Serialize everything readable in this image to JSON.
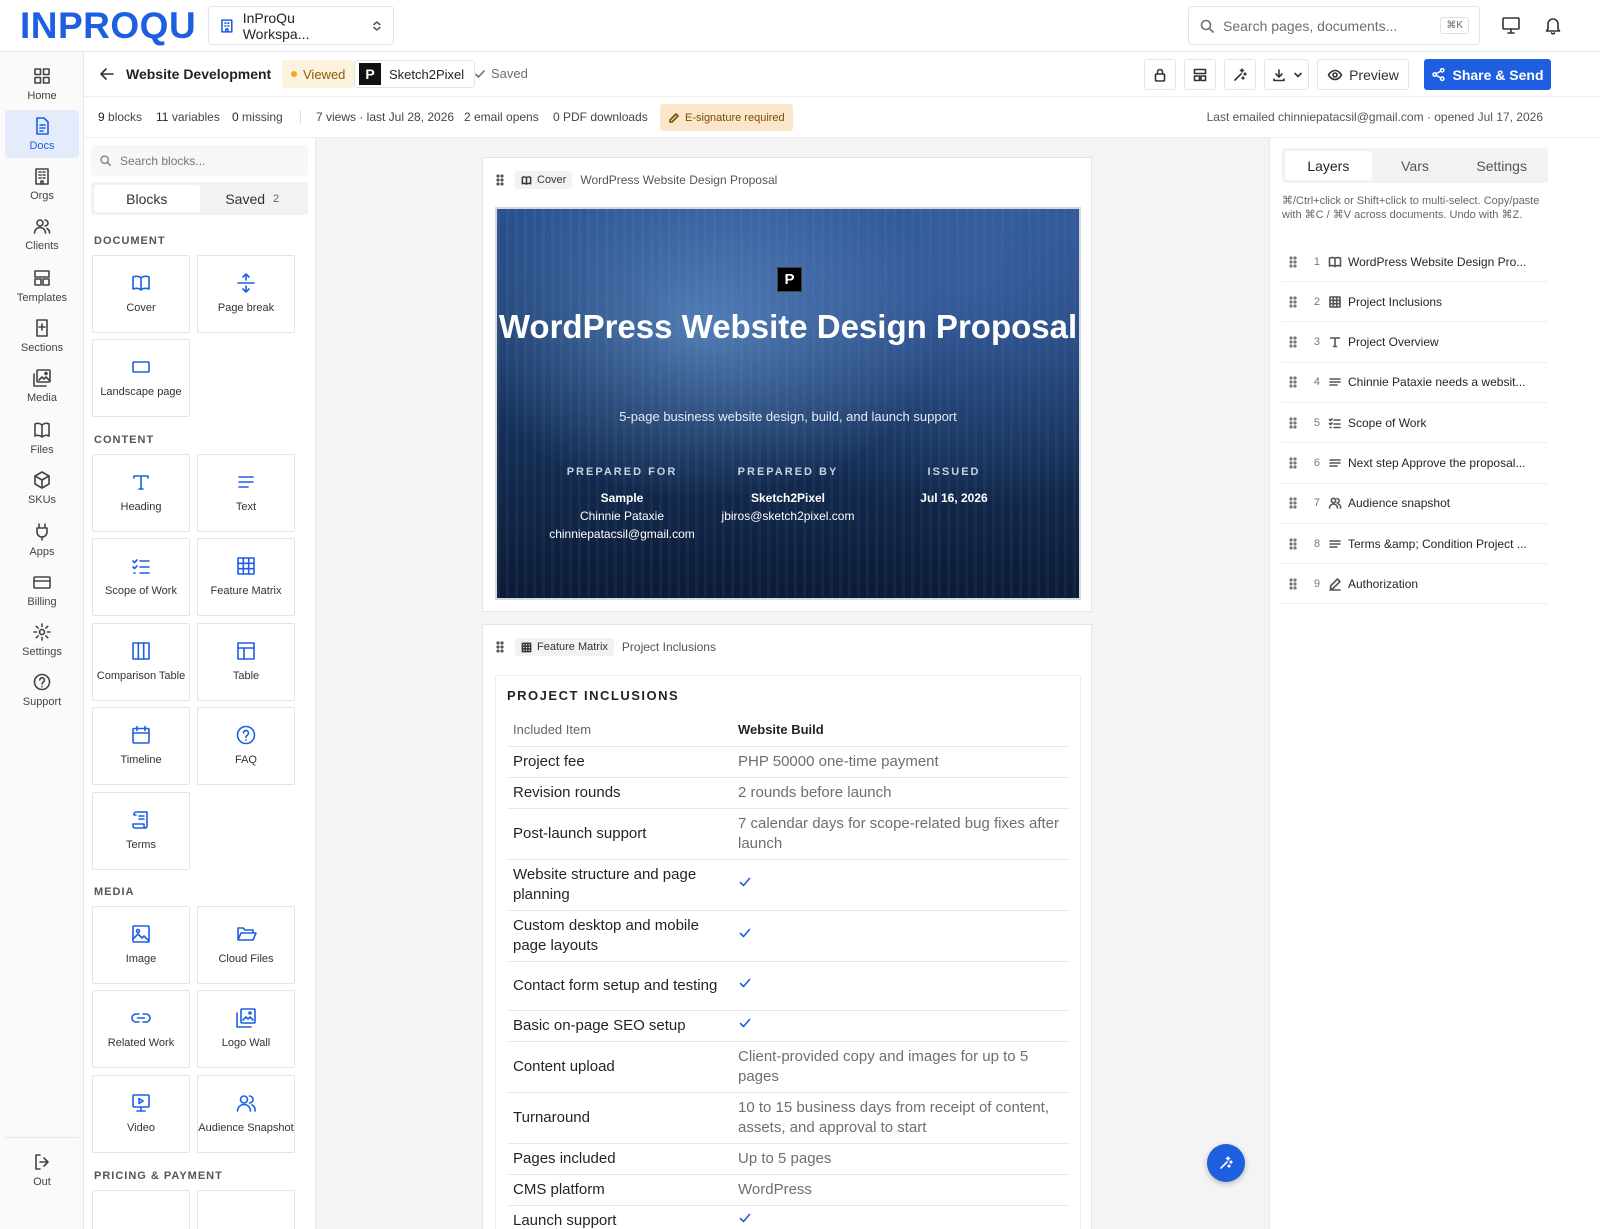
{
  "app": {
    "logo": "INPROQU",
    "workspace": "InProQu Workspa...",
    "search_placeholder": "Search pages, documents...",
    "search_shortcut": "⌘K"
  },
  "nav": [
    {
      "label": "Home",
      "icon": "home-icon"
    },
    {
      "label": "Docs",
      "icon": "docs-icon",
      "active": true
    },
    {
      "label": "Orgs",
      "icon": "orgs-icon"
    },
    {
      "label": "Clients",
      "icon": "clients-icon"
    },
    {
      "label": "Templates",
      "icon": "templates-icon"
    },
    {
      "label": "Sections",
      "icon": "sections-icon"
    },
    {
      "label": "Media",
      "icon": "media-icon"
    },
    {
      "label": "Files",
      "icon": "files-icon"
    },
    {
      "label": "SKUs",
      "icon": "skus-icon"
    },
    {
      "label": "Apps",
      "icon": "apps-icon"
    },
    {
      "label": "Billing",
      "icon": "billing-icon"
    },
    {
      "label": "Settings",
      "icon": "settings-icon"
    },
    {
      "label": "Support",
      "icon": "support-icon"
    }
  ],
  "nav_out": "Out",
  "doc": {
    "title": "Website Development",
    "status": "Viewed",
    "client": "Sketch2Pixel",
    "client_logo": "P",
    "saved": "Saved",
    "preview_label": "Preview",
    "share_label": "Share & Send"
  },
  "stats": {
    "blocks": "9",
    "blocks_label": "blocks",
    "variables": "11",
    "variables_label": "variables",
    "missing": "0",
    "missing_label": "missing",
    "views": "7 views · last Jul 28, 2026",
    "email_opens": "2 email opens",
    "pdf": "0 PDF downloads",
    "esig": "E-signature required",
    "last_emailed": "Last emailed chinniepatacsil@gmail.com · opened Jul 17, 2026"
  },
  "palette": {
    "search_placeholder": "Search blocks...",
    "tab_blocks": "Blocks",
    "tab_saved": "Saved",
    "saved_count": "2",
    "sections": {
      "document": "DOCUMENT",
      "content": "CONTENT",
      "media": "MEDIA",
      "pricing": "PRICING & PAYMENT"
    },
    "document": [
      "Cover",
      "Page break",
      "Landscape page"
    ],
    "content": [
      "Heading",
      "Text",
      "Scope of Work",
      "Feature Matrix",
      "Comparison Table",
      "Table",
      "Timeline",
      "FAQ",
      "Terms"
    ],
    "media": [
      "Image",
      "Cloud Files",
      "Related Work",
      "Logo Wall",
      "Video",
      "Audience Snapshot"
    ]
  },
  "cover_block": {
    "tag": "Cover",
    "name": "WordPress Website Design Proposal",
    "title": "WordPress Website Design Proposal",
    "subtitle": "5-page business website design, build, and launch support",
    "prepared_for_label": "PREPARED FOR",
    "prepared_for_org": "Sample",
    "prepared_for_name": "Chinnie Pataxie",
    "prepared_for_email": "chinniepatacsil@gmail.com",
    "prepared_by_label": "PREPARED BY",
    "prepared_by_org": "Sketch2Pixel",
    "prepared_by_email": "jbiros@sketch2pixel.com",
    "issued_label": "ISSUED",
    "issued_date": "Jul 16, 2026",
    "logo": "P"
  },
  "matrix_block": {
    "tag": "Feature Matrix",
    "name": "Project Inclusions",
    "title": "PROJECT INCLUSIONS",
    "col1": "Included Item",
    "col2": "Website Build",
    "rows": [
      {
        "item": "Project fee",
        "value": "PHP 50000 one-time payment"
      },
      {
        "item": "Revision rounds",
        "value": "2 rounds before launch"
      },
      {
        "item": "Post-launch support",
        "value": "7 calendar days for scope-related bug fixes after launch"
      },
      {
        "item": "Website structure and page planning",
        "value": "✓"
      },
      {
        "item": "Custom desktop and mobile page layouts",
        "value": "✓"
      },
      {
        "item": "Contact form setup and testing",
        "value": "✓"
      },
      {
        "item": "Basic on-page SEO setup",
        "value": "✓"
      },
      {
        "item": "Content upload",
        "value": "Client-provided copy and images for up to 5 pages"
      },
      {
        "item": "Turnaround",
        "value": "10 to 15 business days from receipt of content, assets, and approval to start"
      },
      {
        "item": "Pages included",
        "value": "Up to 5 pages"
      },
      {
        "item": "CMS platform",
        "value": "WordPress"
      },
      {
        "item": "Launch support",
        "value": "✓"
      }
    ]
  },
  "right": {
    "tabs": [
      "Layers",
      "Vars",
      "Settings"
    ],
    "help": "⌘/Ctrl+click or Shift+click to multi-select. Copy/paste with ⌘C / ⌘V across documents. Undo with ⌘Z.",
    "layers": [
      {
        "n": "1",
        "icon": "cover-icon",
        "label": "WordPress Website Design Pro..."
      },
      {
        "n": "2",
        "icon": "grid-icon",
        "label": "Project Inclusions"
      },
      {
        "n": "3",
        "icon": "heading-icon",
        "label": "Project Overview"
      },
      {
        "n": "4",
        "icon": "text-icon",
        "label": "Chinnie Pataxie needs a websit..."
      },
      {
        "n": "5",
        "icon": "scope-icon",
        "label": "Scope of Work"
      },
      {
        "n": "6",
        "icon": "text-icon",
        "label": "Next step Approve the proposal..."
      },
      {
        "n": "7",
        "icon": "audience-icon",
        "label": "Audience snapshot"
      },
      {
        "n": "8",
        "icon": "text-icon",
        "label": "Terms &amp; Condition Project ..."
      },
      {
        "n": "9",
        "icon": "signature-icon",
        "label": "Authorization"
      }
    ]
  },
  "colors": {
    "accent": "#1d5fe0",
    "viewed_bg": "#fdf2dd",
    "esig_bg": "#fbe6cc"
  }
}
